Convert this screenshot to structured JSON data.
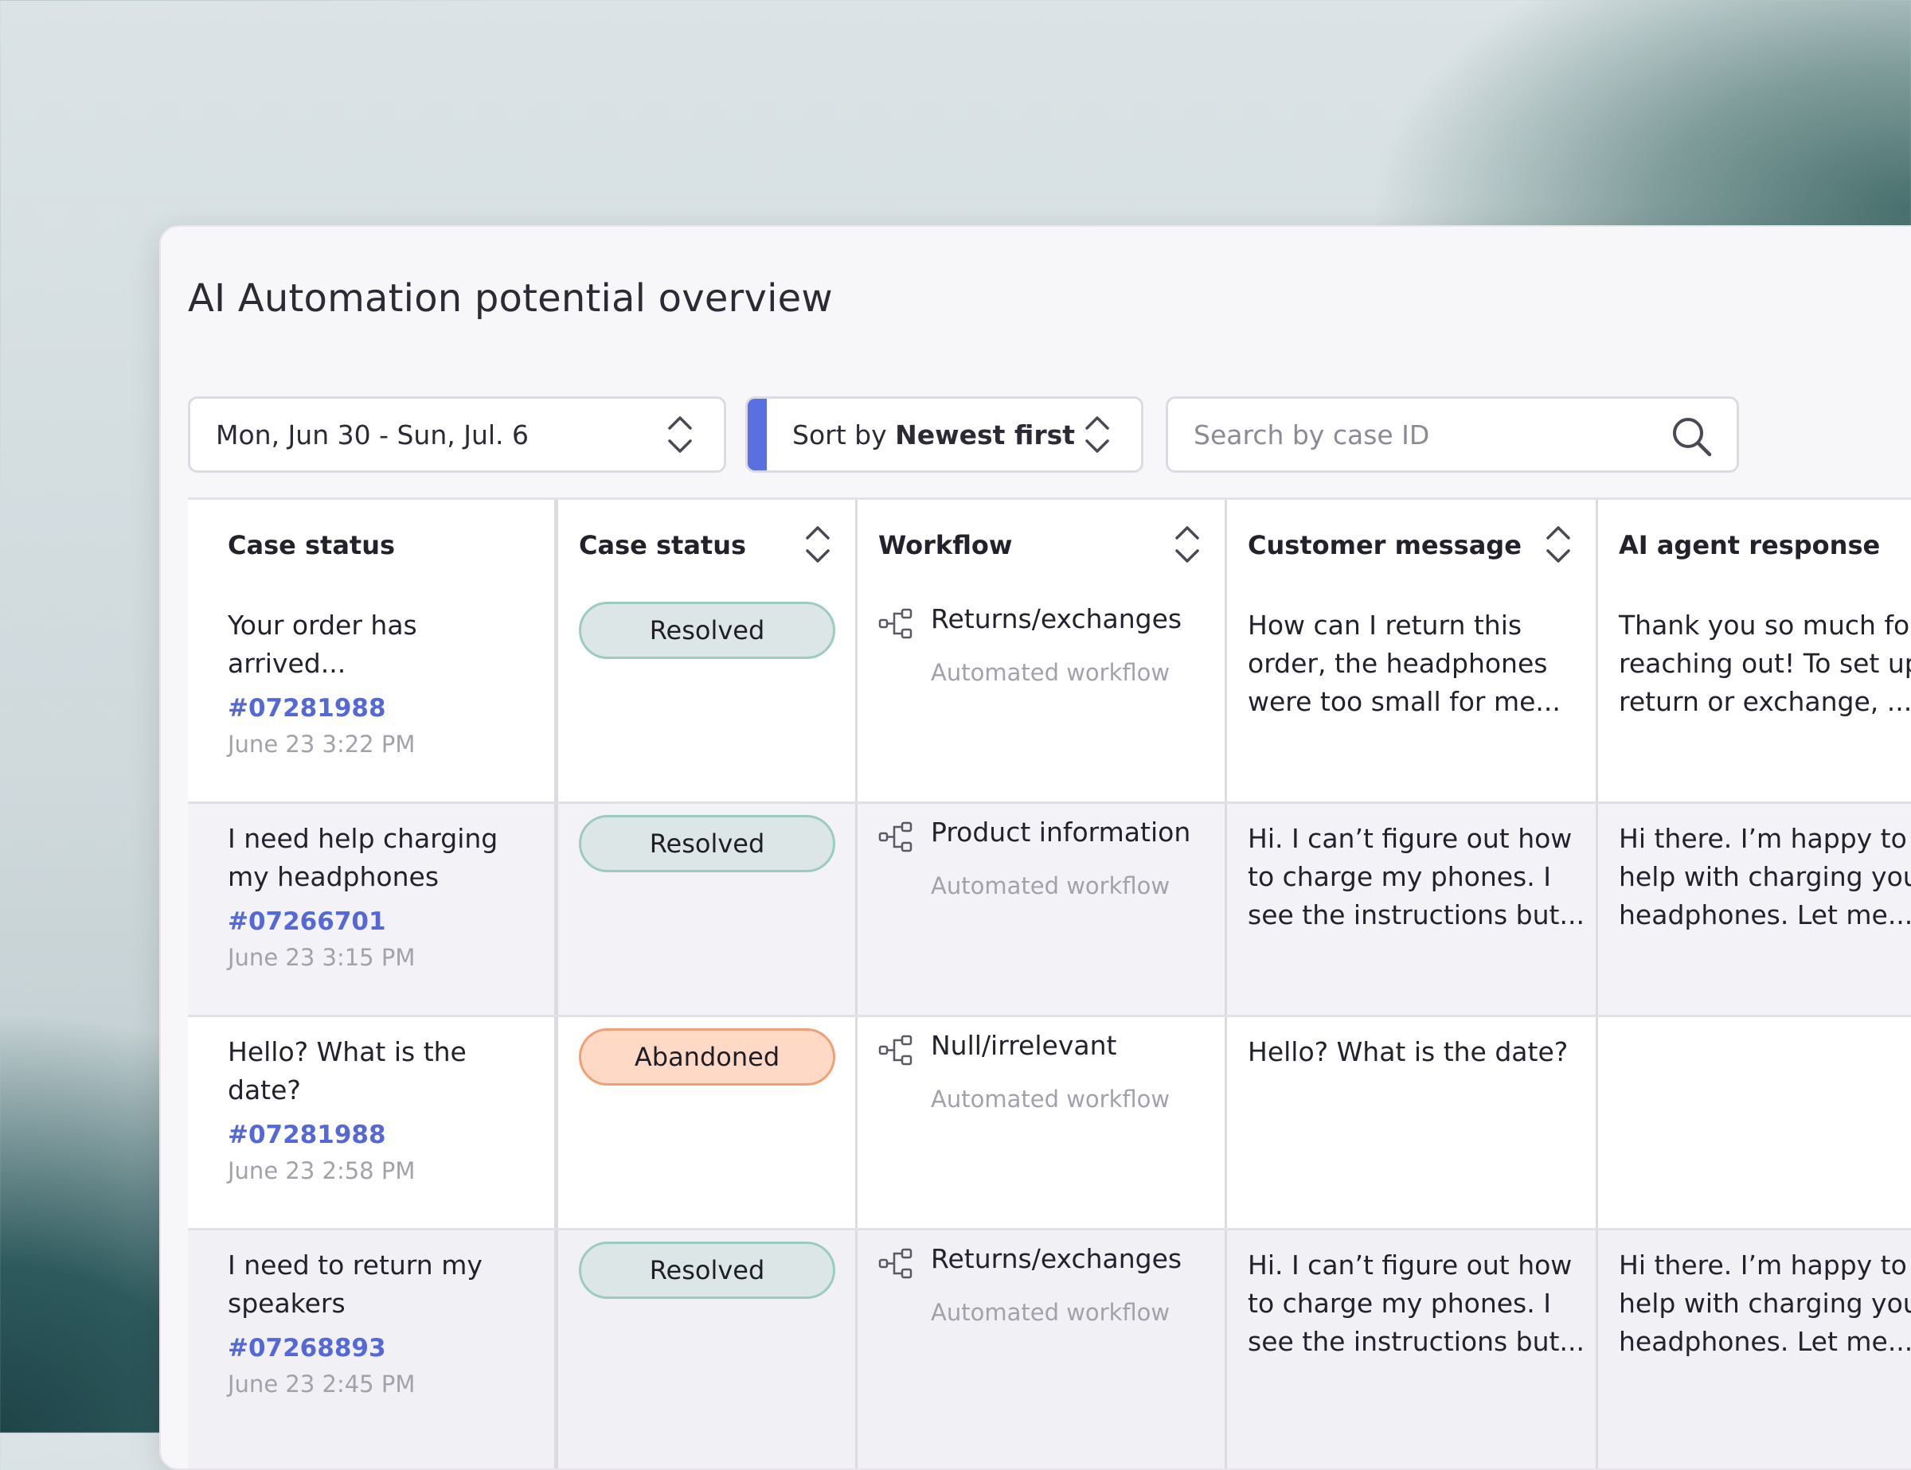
{
  "title": "AI Automation potential overview",
  "filters": {
    "date_range": "Mon, Jun 30 - Sun, Jul. 6",
    "sort_prefix": "Sort by ",
    "sort_value": "Newest first",
    "search_placeholder": "Search by case ID"
  },
  "table": {
    "columns": [
      "Case status",
      "Case status",
      "Workflow",
      "Customer message",
      "AI agent response"
    ],
    "rows": [
      {
        "summary": "Your order has arrived...",
        "case_id": "#07281988",
        "timestamp": "June 23 3:22 PM",
        "status": "Resolved",
        "workflow": "Returns/exchanges",
        "workflow_type": "Automated workflow",
        "customer_message": "How can I return this order, the headphones were too small for me...",
        "ai_response": [
          "Thank you so much for",
          "reaching out! To set up",
          "return or exchange, ...."
        ]
      },
      {
        "summary": "I need help charging my headphones",
        "case_id": "#07266701",
        "timestamp": "June 23 3:15 PM",
        "status": "Resolved",
        "workflow": "Product information",
        "workflow_type": "Automated workflow",
        "customer_message": "Hi. I can’t figure out how to charge my phones. I see the instructions but...",
        "ai_response": [
          "Hi there. I’m happy to",
          "help with charging your",
          "headphones. Let me..."
        ]
      },
      {
        "summary": "Hello? What is the date?",
        "case_id": "#07281988",
        "timestamp": "June 23 2:58 PM",
        "status": "Abandoned",
        "workflow": "Null/irrelevant",
        "workflow_type": "Automated workflow",
        "customer_message": "Hello? What is the date?",
        "ai_response": [
          "",
          "",
          ""
        ]
      },
      {
        "summary": "I need to return my speakers",
        "case_id": "#07268893",
        "timestamp": "June 23 2:45 PM",
        "status": "Resolved",
        "workflow": "Returns/exchanges",
        "workflow_type": "Automated workflow",
        "customer_message": "Hi. I can’t figure out how to charge my phones. I see the instructions but...",
        "ai_response": [
          "Hi there. I’m happy to",
          "help with charging your",
          "headphones. Let me..."
        ]
      }
    ]
  },
  "colors": {
    "accent": "#5a6fe0",
    "case_id": "#5468d6",
    "resolved_bg": "#dde6e6",
    "abandoned_bg": "#fdd9c6"
  },
  "icons": [
    "chevron-up-down-icon",
    "search-icon",
    "workflow-icon"
  ]
}
